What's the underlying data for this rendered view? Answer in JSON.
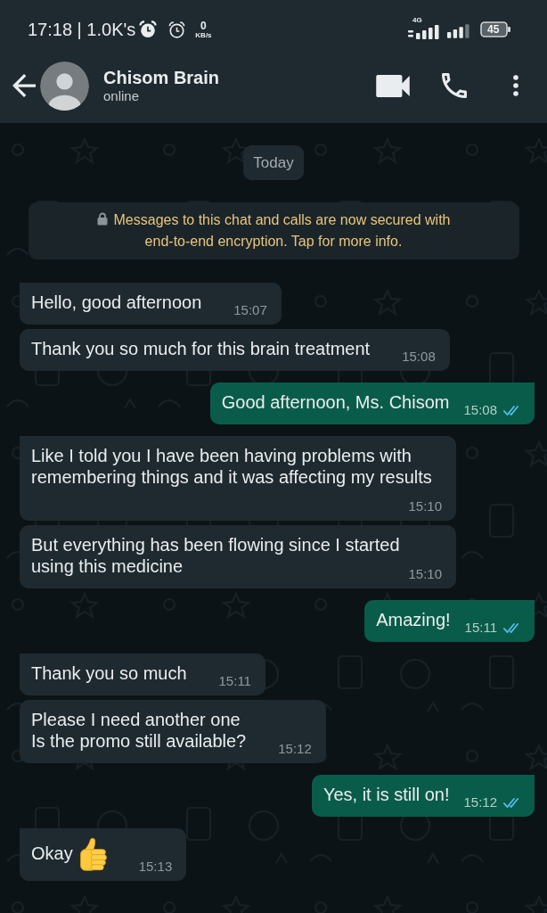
{
  "status_bar": {
    "time_text": "17:18 | 1.0K's",
    "speed_value": "0",
    "speed_unit": "KB/s",
    "network_label": "4G",
    "battery_text": "45"
  },
  "header": {
    "contact_name": "Chisom Brain",
    "status": "online"
  },
  "chat": {
    "date_chip": "Today",
    "encryption_notice": "Messages to this chat and calls are now secured with end-to-end encryption. Tap for more info.",
    "messages": [
      {
        "kind": "incoming",
        "text": "Hello, good afternoon",
        "time": "15:07"
      },
      {
        "kind": "incoming",
        "text": "Thank you so much for this brain treatment",
        "time": "15:08"
      },
      {
        "kind": "outgoing",
        "text": "Good afternoon, Ms. Chisom",
        "time": "15:08",
        "read": true
      },
      {
        "kind": "incoming",
        "text": "Like I told you I have been having problems with remembering things and it was affecting my results",
        "time": "15:10"
      },
      {
        "kind": "incoming",
        "text": "But everything has been flowing since I started using this medicine",
        "time": "15:10"
      },
      {
        "kind": "outgoing",
        "text": "Amazing!",
        "time": "15:11",
        "read": true
      },
      {
        "kind": "incoming",
        "text": "Thank you so much",
        "time": "15:11"
      },
      {
        "kind": "incoming",
        "text": "Please I need another one\nIs the promo still available?",
        "time": "15:12"
      },
      {
        "kind": "outgoing",
        "text": "Yes, it is still on!",
        "time": "15:12",
        "read": true
      },
      {
        "kind": "incoming",
        "text": "Okay",
        "emoji": true,
        "time": "15:13"
      }
    ]
  }
}
